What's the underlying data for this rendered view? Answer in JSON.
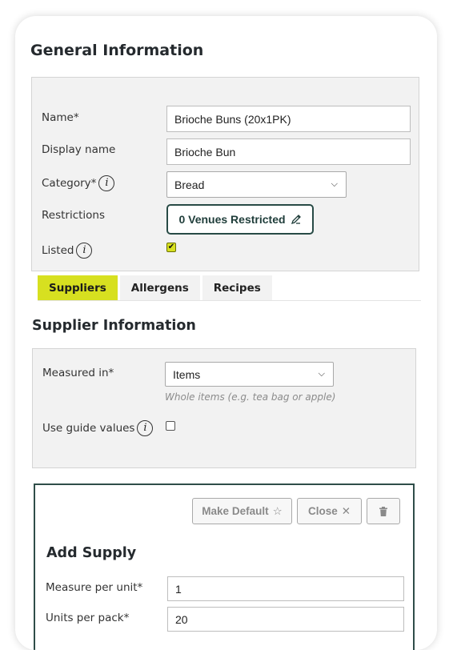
{
  "general": {
    "title": "General Information",
    "name_label": "Name*",
    "name_value": "Brioche Buns (20x1PK)",
    "display_name_label": "Display name",
    "display_name_value": "Brioche Bun",
    "category_label": "Category*",
    "category_value": "Bread",
    "restrictions_label": "Restrictions",
    "restrictions_button": "0 Venues Restricted",
    "listed_label": "Listed",
    "listed_checked": true
  },
  "tabs": [
    {
      "label": "Suppliers",
      "active": true
    },
    {
      "label": "Allergens",
      "active": false
    },
    {
      "label": "Recipes",
      "active": false
    }
  ],
  "supplier": {
    "title": "Supplier Information",
    "measured_in_label": "Measured in*",
    "measured_in_value": "Items",
    "measured_in_hint": "Whole items (e.g. tea bag or apple)",
    "guide_values_label": "Use guide values",
    "guide_values_checked": false
  },
  "supply": {
    "make_default_label": "Make Default",
    "close_label": "Close",
    "title": "Add Supply",
    "measure_per_unit_label": "Measure per unit*",
    "measure_per_unit_value": "1",
    "units_per_pack_label": "Units per pack*",
    "units_per_pack_value": "20"
  },
  "colors": {
    "accent": "#d7e020",
    "primary_dark": "#284b46",
    "panel_bg": "#f2f2f2"
  },
  "icons": [
    "info-icon",
    "chevron-down-icon",
    "pencil-icon",
    "check-icon",
    "star-icon",
    "close-icon",
    "trash-icon"
  ]
}
